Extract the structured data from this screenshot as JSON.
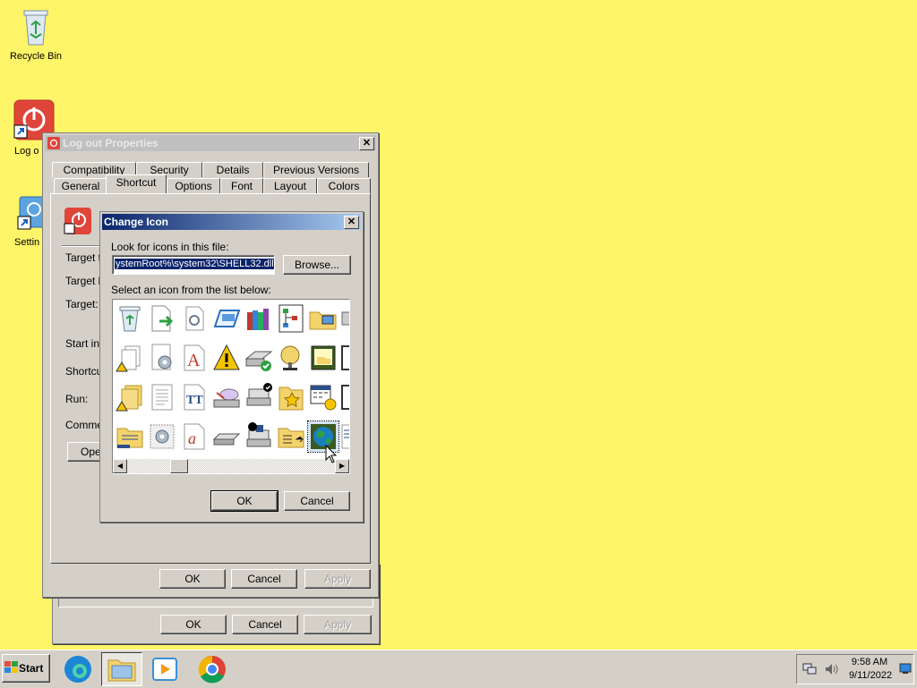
{
  "desktop": {
    "icons": [
      {
        "label": "Recycle Bin"
      },
      {
        "label": "Log o"
      },
      {
        "label": "Settin"
      }
    ]
  },
  "props_window": {
    "title": "Log out Properties",
    "tabs_row1": [
      "Compatibility",
      "Security",
      "Details",
      "Previous Versions"
    ],
    "tabs_row2": [
      "General",
      "Shortcut",
      "Options",
      "Font",
      "Layout",
      "Colors"
    ],
    "selected_tab": "Shortcut",
    "fields": [
      "Target ty",
      "Target lo",
      "Target:",
      "Start in:",
      "Shortcut",
      "Run:",
      "Commen"
    ],
    "open_button": "Ope",
    "ok": "OK",
    "cancel": "Cancel",
    "apply": "Apply"
  },
  "behind_buttons": {
    "ok": "OK",
    "cancel": "Cancel",
    "apply": "Apply"
  },
  "change_icon": {
    "title": "Change Icon",
    "look_label": "Look for icons in this file:",
    "path_value": "ystemRoot%\\system32\\SHELL32.dll",
    "browse": "Browse...",
    "select_label": "Select an icon from the list below:",
    "ok": "OK",
    "cancel": "Cancel"
  },
  "taskbar": {
    "start": "Start",
    "time": "9:58 AM",
    "date": "9/11/2022"
  }
}
